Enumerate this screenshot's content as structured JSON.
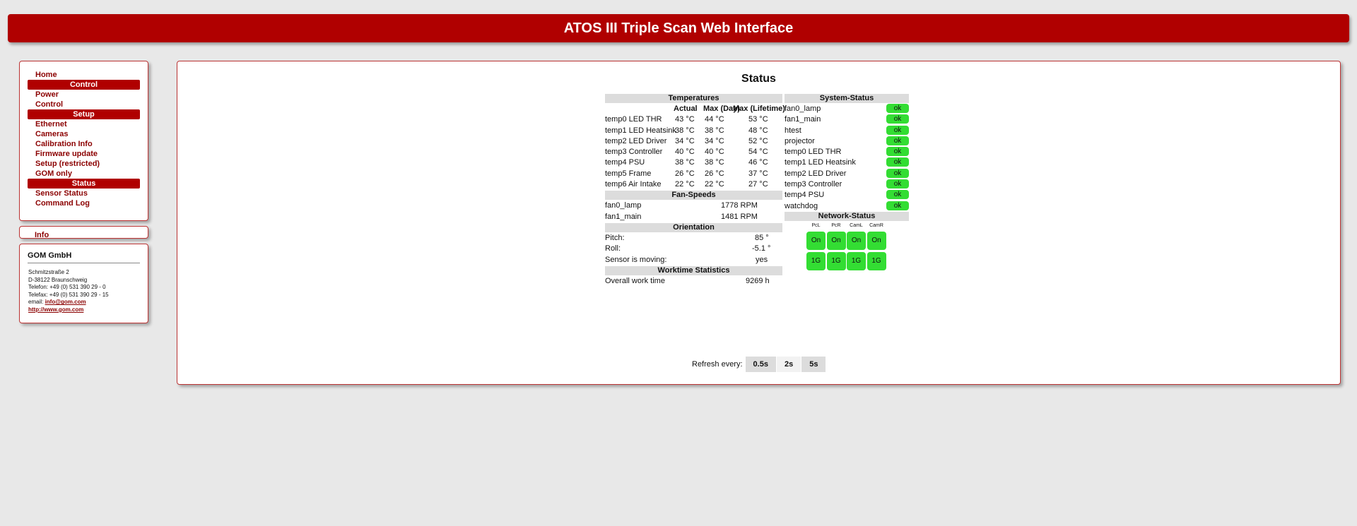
{
  "header": {
    "title": "ATOS III Triple Scan Web Interface"
  },
  "nav": {
    "home": "Home",
    "control_section": "Control",
    "power": "Power",
    "control": "Control",
    "setup_section": "Setup",
    "ethernet": "Ethernet",
    "cameras": "Cameras",
    "calibration": "Calibration Info",
    "firmware": "Firmware update",
    "setup_restricted": "Setup (restricted)",
    "gom_only": "GOM only",
    "status_section": "Status",
    "sensor_status": "Sensor Status",
    "command_log": "Command Log"
  },
  "info": {
    "label": "Info"
  },
  "company": {
    "name": "GOM GmbH",
    "street": "Schmitzstraße 2",
    "city": "D-38122 Braunschweig",
    "phone": "Telefon: +49 (0) 531 390 29 - 0",
    "fax": "Telefax: +49 (0) 531 390 29 - 15",
    "email_label": "email: ",
    "email": "info@gom.com",
    "web": "http://www.gom.com"
  },
  "status": {
    "title": "Status",
    "temperatures": {
      "heading": "Temperatures",
      "col_actual": "Actual",
      "col_max_day": "Max (Day)",
      "col_max_life": "Max (Lifetime)",
      "rows": [
        {
          "name": "temp0 LED THR",
          "actual": "43 °C",
          "day": "44 °C",
          "life": "53 °C"
        },
        {
          "name": "temp1 LED Heatsink",
          "actual": "38 °C",
          "day": "38 °C",
          "life": "48 °C"
        },
        {
          "name": "temp2 LED Driver",
          "actual": "34 °C",
          "day": "34 °C",
          "life": "52 °C"
        },
        {
          "name": "temp3 Controller",
          "actual": "40 °C",
          "day": "40 °C",
          "life": "54 °C"
        },
        {
          "name": "temp4 PSU",
          "actual": "38 °C",
          "day": "38 °C",
          "life": "46 °C"
        },
        {
          "name": "temp5 Frame",
          "actual": "26 °C",
          "day": "26 °C",
          "life": "37 °C"
        },
        {
          "name": "temp6 Air Intake",
          "actual": "22 °C",
          "day": "22 °C",
          "life": "27 °C"
        }
      ]
    },
    "fans": {
      "heading": "Fan-Speeds",
      "rows": [
        {
          "name": "fan0_lamp",
          "value": "1778 RPM"
        },
        {
          "name": "fan1_main",
          "value": "1481 RPM"
        }
      ]
    },
    "orientation": {
      "heading": "Orientation",
      "pitch_label": "Pitch:",
      "pitch": "85 °",
      "roll_label": "Roll:",
      "roll": "-5.1 °",
      "moving_label": "Sensor is moving:",
      "moving": "yes"
    },
    "worktime": {
      "heading": "Worktime Statistics",
      "label": "Overall work time",
      "value": "9269 h"
    },
    "system": {
      "heading": "System-Status",
      "rows": [
        {
          "name": "fan0_lamp",
          "state": "ok"
        },
        {
          "name": "fan1_main",
          "state": "ok"
        },
        {
          "name": "htest",
          "state": "ok"
        },
        {
          "name": "projector",
          "state": "ok"
        },
        {
          "name": "temp0 LED THR",
          "state": "ok"
        },
        {
          "name": "temp1 LED Heatsink",
          "state": "ok"
        },
        {
          "name": "temp2 LED Driver",
          "state": "ok"
        },
        {
          "name": "temp3 Controller",
          "state": "ok"
        },
        {
          "name": "temp4 PSU",
          "state": "ok"
        },
        {
          "name": "watchdog",
          "state": "ok"
        }
      ]
    },
    "network": {
      "heading": "Network-Status",
      "labels": [
        "PcL",
        "PcR",
        "CamL",
        "CamR"
      ],
      "link": [
        "On",
        "On",
        "On",
        "On"
      ],
      "speed": [
        "1G",
        "1G",
        "1G",
        "1G"
      ]
    },
    "refresh": {
      "label": "Refresh every:",
      "options": [
        "0.5s",
        "2s",
        "5s"
      ],
      "selected": "2s"
    }
  },
  "colors": {
    "brand": "#b00000",
    "ok_green": "#33dd33",
    "section_gray": "#dcdcdc"
  }
}
